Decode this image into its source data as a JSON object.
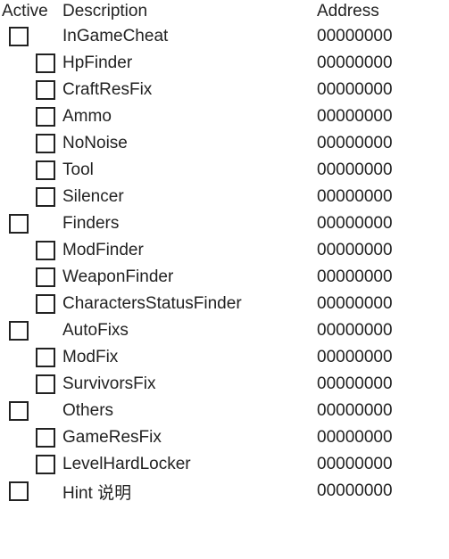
{
  "columns": {
    "active": "Active",
    "description": "Description",
    "address": "Address"
  },
  "entries": [
    {
      "level": 0,
      "description": "InGameCheat",
      "address": "00000000",
      "checked": false
    },
    {
      "level": 1,
      "description": "HpFinder",
      "address": "00000000",
      "checked": false
    },
    {
      "level": 1,
      "description": "CraftResFix",
      "address": "00000000",
      "checked": false
    },
    {
      "level": 1,
      "description": "Ammo",
      "address": "00000000",
      "checked": false
    },
    {
      "level": 1,
      "description": "NoNoise",
      "address": "00000000",
      "checked": false
    },
    {
      "level": 1,
      "description": "Tool",
      "address": "00000000",
      "checked": false
    },
    {
      "level": 1,
      "description": "Silencer",
      "address": "00000000",
      "checked": false
    },
    {
      "level": 0,
      "description": "Finders",
      "address": "00000000",
      "checked": false
    },
    {
      "level": 1,
      "description": "ModFinder",
      "address": "00000000",
      "checked": false
    },
    {
      "level": 1,
      "description": "WeaponFinder",
      "address": "00000000",
      "checked": false
    },
    {
      "level": 1,
      "description": "CharactersStatusFinder",
      "address": "00000000",
      "checked": false
    },
    {
      "level": 0,
      "description": "AutoFixs",
      "address": "00000000",
      "checked": false
    },
    {
      "level": 1,
      "description": "ModFix",
      "address": "00000000",
      "checked": false
    },
    {
      "level": 1,
      "description": "SurvivorsFix",
      "address": "00000000",
      "checked": false
    },
    {
      "level": 0,
      "description": "Others",
      "address": "00000000",
      "checked": false
    },
    {
      "level": 1,
      "description": "GameResFix",
      "address": "00000000",
      "checked": false
    },
    {
      "level": 1,
      "description": "LevelHardLocker",
      "address": "00000000",
      "checked": false
    },
    {
      "level": 0,
      "description": "Hint 说明",
      "address": "00000000",
      "checked": false
    }
  ],
  "layout": {
    "indentPx": 30,
    "baseCheckboxOffsetPx": 10
  }
}
